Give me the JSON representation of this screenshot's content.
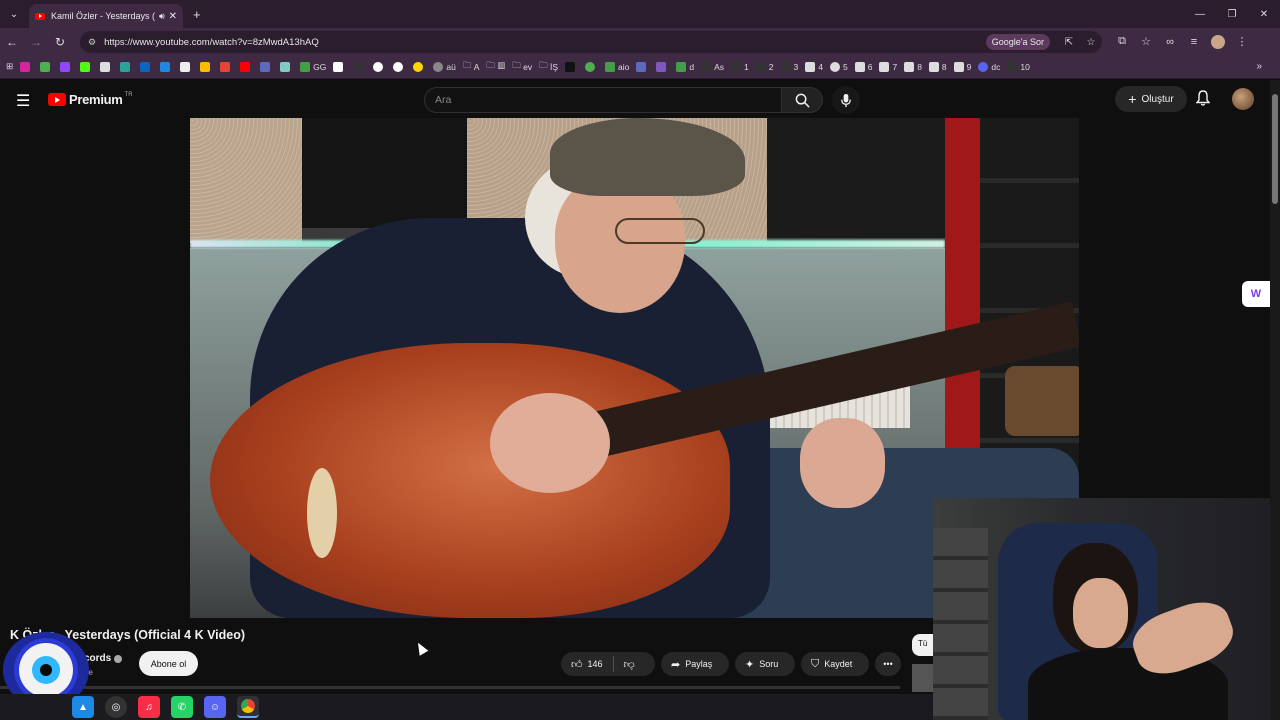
{
  "browser": {
    "tab": {
      "title": "Kamil Özler - Yesterdays (O",
      "audio_icon": "speaker-icon"
    },
    "url": "https://www.youtube.com/watch?v=8zMwdA13hAQ",
    "gsor_label": "Google'a Sor",
    "bookmarks": [
      "GG",
      "aü",
      "A",
      "ev",
      "İŞ",
      "aio",
      "d",
      "As",
      "1",
      "2",
      "3",
      "4",
      "5",
      "6",
      "7",
      "8",
      "8",
      "9",
      "dc",
      "10"
    ]
  },
  "youtube": {
    "logo_text": "Premium",
    "region": "TR",
    "search_placeholder": "Ara",
    "create_label": "Oluştur",
    "video": {
      "title": "Kamil Özler - Yesterdays (Official 4 K Video)",
      "title_visible": "K  Özler - Yesterdays (Official 4 K Video)",
      "channel_visible": "cords",
      "subs_visible": "ne",
      "subscribe_label": "Abone ol",
      "likes": "146",
      "share_label": "Paylaş",
      "ask_label": "Soru",
      "save_label": "Kaydet",
      "chip_label": "Tü"
    }
  },
  "colors": {
    "accent": "#ff0000",
    "browser_frame": "#3f2a44"
  }
}
